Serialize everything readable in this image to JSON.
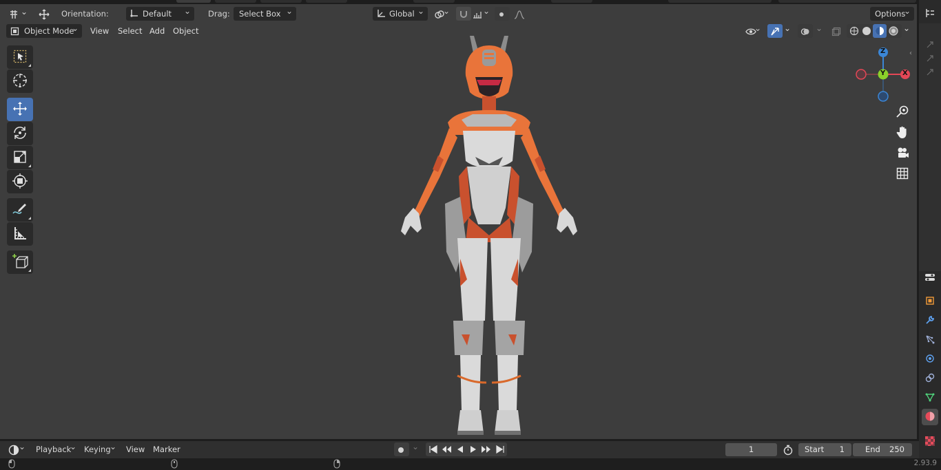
{
  "header": {
    "orientation_label": "Orientation:",
    "orientation_value": "Default",
    "drag_label": "Drag:",
    "drag_value": "Select Box",
    "transform_space": "Global",
    "options_label": "Options"
  },
  "viewport_header": {
    "mode": "Object Mode",
    "menu": [
      "View",
      "Select",
      "Add",
      "Object"
    ]
  },
  "toolbar": {
    "tools": [
      "select-box-icon",
      "cursor-icon",
      "move-icon",
      "rotate-icon",
      "scale-icon",
      "transform-icon",
      "annotate-icon",
      "measure-icon",
      "add-cube-icon"
    ],
    "active_tool": "move-icon"
  },
  "gizmo": {
    "x": "X",
    "y": "Y",
    "z": "Z"
  },
  "nav_icons": [
    "zoom-icon",
    "pan-hand-icon",
    "camera-icon",
    "ortho-grid-icon"
  ],
  "timeline": {
    "menu": [
      "Playback",
      "Keying",
      "View",
      "Marker"
    ],
    "current_frame": "1",
    "start_label": "Start",
    "start_value": "1",
    "end_label": "End",
    "end_value": "250"
  },
  "status": {
    "version": "2.93.9"
  },
  "colors": {
    "accent": "#4772b3",
    "viewport_bg": "#3d3d3d",
    "axis_x": "#e54756",
    "axis_y": "#8bd12a",
    "axis_z": "#3b86d6",
    "suit_orange": "#e9743a",
    "suit_white": "#dadada"
  }
}
